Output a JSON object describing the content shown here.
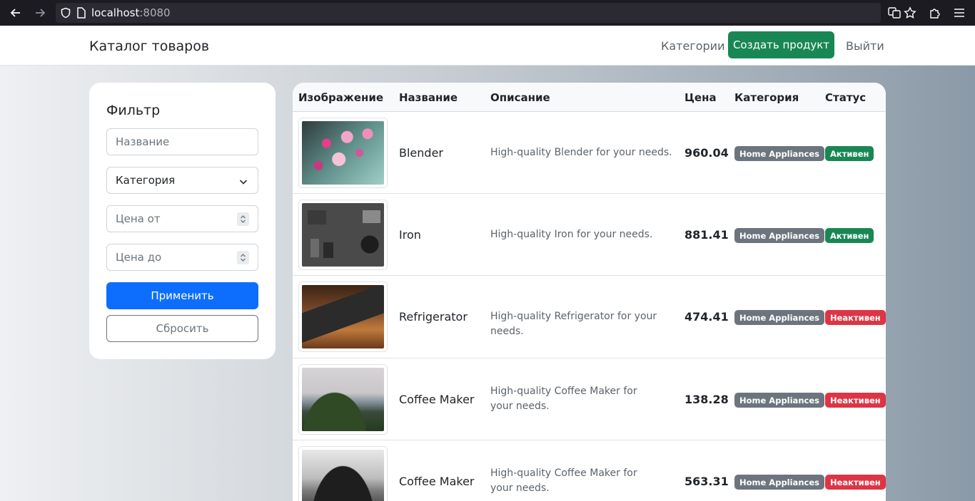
{
  "browser": {
    "url_host": "localhost",
    "url_port": ":8080"
  },
  "navbar": {
    "brand": "Каталог товаров",
    "categories_link": "Категории",
    "create_button": "Создать продукт",
    "logout_link": "Выйти"
  },
  "filter": {
    "title": "Фильтр",
    "name_placeholder": "Название",
    "category_selected": "Категория",
    "price_from_placeholder": "Цена от",
    "price_to_placeholder": "Цена до",
    "apply_button": "Применить",
    "reset_button": "Сбросить"
  },
  "table": {
    "headers": [
      "Изображение",
      "Название",
      "Описание",
      "Цена",
      "Категория",
      "Статус"
    ],
    "rows": [
      {
        "name": "Blender",
        "description": "High-quality Blender for your needs.",
        "price": "960.04",
        "category": "Home Appliances",
        "status": "Активен"
      },
      {
        "name": "Iron",
        "description": "High-quality Iron for your needs.",
        "price": "881.41",
        "category": "Home Appliances",
        "status": "Активен"
      },
      {
        "name": "Refrigerator",
        "description": "High-quality Refrigerator for your needs.",
        "price": "474.41",
        "category": "Home Appliances",
        "status": "Неактивен"
      },
      {
        "name": "Coffee Maker",
        "description": "High-quality Coffee Maker for your needs.",
        "price": "138.28",
        "category": "Home Appliances",
        "status": "Неактивен"
      },
      {
        "name": "Coffee Maker",
        "description": "High-quality Coffee Maker for your needs.",
        "price": "563.31",
        "category": "Home Appliances",
        "status": "Неактивен"
      }
    ]
  },
  "colors": {
    "active": "#198754",
    "inactive": "#dc3545",
    "primary": "#0d6efd",
    "category_badge": "#6c757d"
  },
  "icons": {
    "back": "arrow-left-icon",
    "forward": "arrow-right-icon",
    "shield": "shield-icon",
    "page": "page-icon",
    "translate": "translate-icon",
    "bookmark": "star-icon",
    "extensions": "puzzle-icon",
    "menu": "hamburger-icon"
  }
}
